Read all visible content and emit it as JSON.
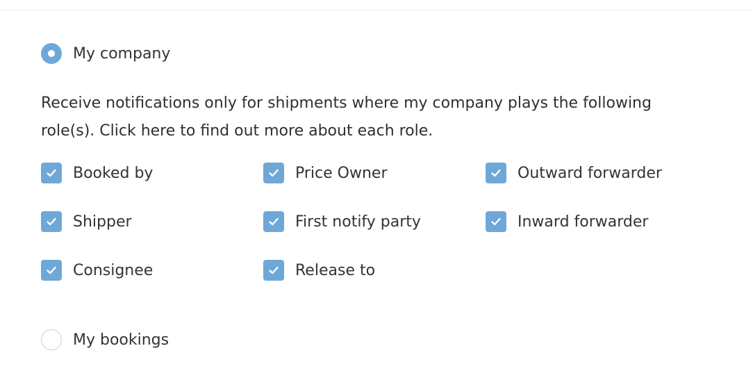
{
  "options": {
    "my_company": {
      "label": "My company",
      "selected": true
    },
    "my_bookings": {
      "label": "My bookings",
      "selected": false
    }
  },
  "description": "Receive notifications only for shipments where my company plays the following role(s). Click here to find out more about each role.",
  "roles": [
    {
      "label": "Booked by",
      "checked": true
    },
    {
      "label": "Price Owner",
      "checked": true
    },
    {
      "label": "Outward forwarder",
      "checked": true
    },
    {
      "label": "Shipper",
      "checked": true
    },
    {
      "label": "First notify party",
      "checked": true
    },
    {
      "label": "Inward forwarder",
      "checked": true
    },
    {
      "label": "Consignee",
      "checked": true
    },
    {
      "label": "Release to",
      "checked": true
    }
  ],
  "icons": {
    "checkbox": "checkmark-icon",
    "radio_selected": "radio-selected-icon",
    "radio_unselected": "radio-unselected-icon"
  },
  "colors": {
    "accent": "#6fa8d8",
    "text": "#333333",
    "divider": "#ececec",
    "radio_border": "#cfcfcf"
  }
}
